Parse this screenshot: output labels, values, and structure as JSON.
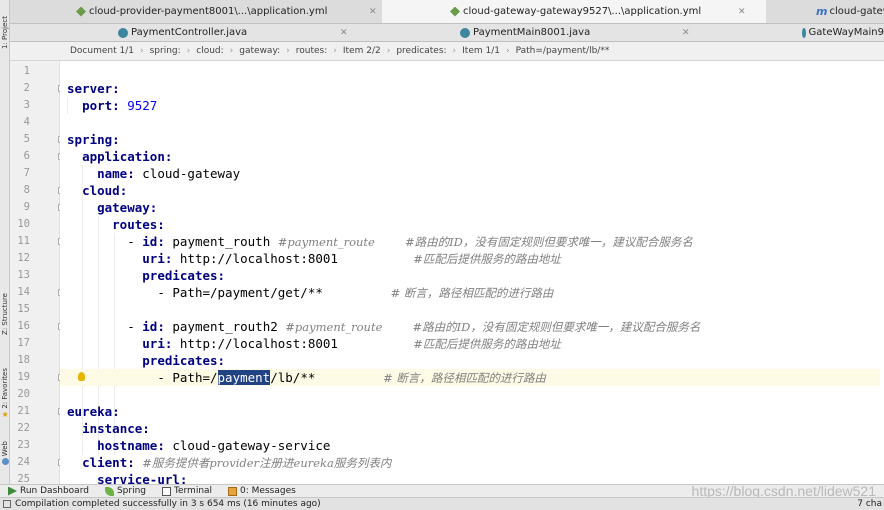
{
  "left_strip": {
    "project": "1: Project",
    "structure": "Z: Structure",
    "favorites": "2: Favorites",
    "web": "Web"
  },
  "tabs_row1": [
    {
      "label": "cloud-provider-payment8001\\...\\application.yml",
      "icon": "yml-icon"
    },
    {
      "label": "cloud-gateway-gateway9527\\...\\application.yml",
      "icon": "yml-icon"
    },
    {
      "label": "cloud-gatew",
      "icon": "maven-icon"
    }
  ],
  "tabs_row2": [
    {
      "label": "PaymentController.java",
      "icon": "class-icon"
    },
    {
      "label": "PaymentMain8001.java",
      "icon": "class-icon"
    },
    {
      "label": "GateWayMain9",
      "icon": "class-icon"
    }
  ],
  "breadcrumb": [
    "Document 1/1",
    "spring:",
    "cloud:",
    "gateway:",
    "routes:",
    "Item 2/2",
    "predicates:",
    "Item 1/1",
    "Path=/payment/lb/**"
  ],
  "code": {
    "line_numbers": [
      "1",
      "2",
      "3",
      "4",
      "5",
      "6",
      "7",
      "8",
      "9",
      "10",
      "11",
      "12",
      "13",
      "14",
      "15",
      "16",
      "17",
      "18",
      "19",
      "20",
      "21",
      "22",
      "23",
      "24",
      "25"
    ],
    "l2_key": "server:",
    "l3_key": "port:",
    "l3_val": "9527",
    "l5_key": "spring:",
    "l6_key": "application:",
    "l7_key": "name:",
    "l7_val": "cloud-gateway",
    "l8_key": "cloud:",
    "l9_key": "gateway:",
    "l10_key": "routes:",
    "l11_dash": "- ",
    "l11_key": "id:",
    "l11_val": "payment_routh",
    "l11_hash": "#payment_route",
    "l11_comment": "#路由的ID，没有固定规则但要求唯一，建议配合服务名",
    "l12_key": "uri:",
    "l12_val": "http://localhost:8001",
    "l12_comment": "#匹配后提供服务的路由地址",
    "l13_key": "predicates:",
    "l14_val": "- Path=/payment/get/**",
    "l14_comment": "# 断言，路径相匹配的进行路由",
    "l16_dash": "- ",
    "l16_key": "id:",
    "l16_val": "payment_routh2",
    "l16_hash": "#payment_route",
    "l16_comment": "#路由的ID，没有固定规则但要求唯一，建议配合服务名",
    "l17_key": "uri:",
    "l17_val": "http://localhost:8001",
    "l17_comment": "#匹配后提供服务的路由地址",
    "l18_key": "predicates:",
    "l19_pre": "- Path=/",
    "l19_sel": "payment",
    "l19_post": "/lb/**",
    "l19_comment": "# 断言，路径相匹配的进行路由",
    "l21_key": "eureka:",
    "l22_key": "instance:",
    "l23_key": "hostname:",
    "l23_val": "cloud-gateway-service",
    "l24_key": "client:",
    "l24_comment": "#服务提供者provider注册进eureka服务列表内",
    "l25_key": "service-url:"
  },
  "toolwindows": {
    "run": "Run Dashboard",
    "spring": "Spring",
    "terminal": "Terminal",
    "messages": "0: Messages"
  },
  "watermark": "https://blog.csdn.net/lidew521",
  "status": {
    "message": "Compilation completed successfully in 3 s 654 ms (16 minutes ago)",
    "right": "7 cha"
  },
  "colors": {
    "keyword": "#000080",
    "number": "#0000ff",
    "comment": "#808080",
    "selection": "#214283",
    "current_line": "#fdfae5"
  }
}
